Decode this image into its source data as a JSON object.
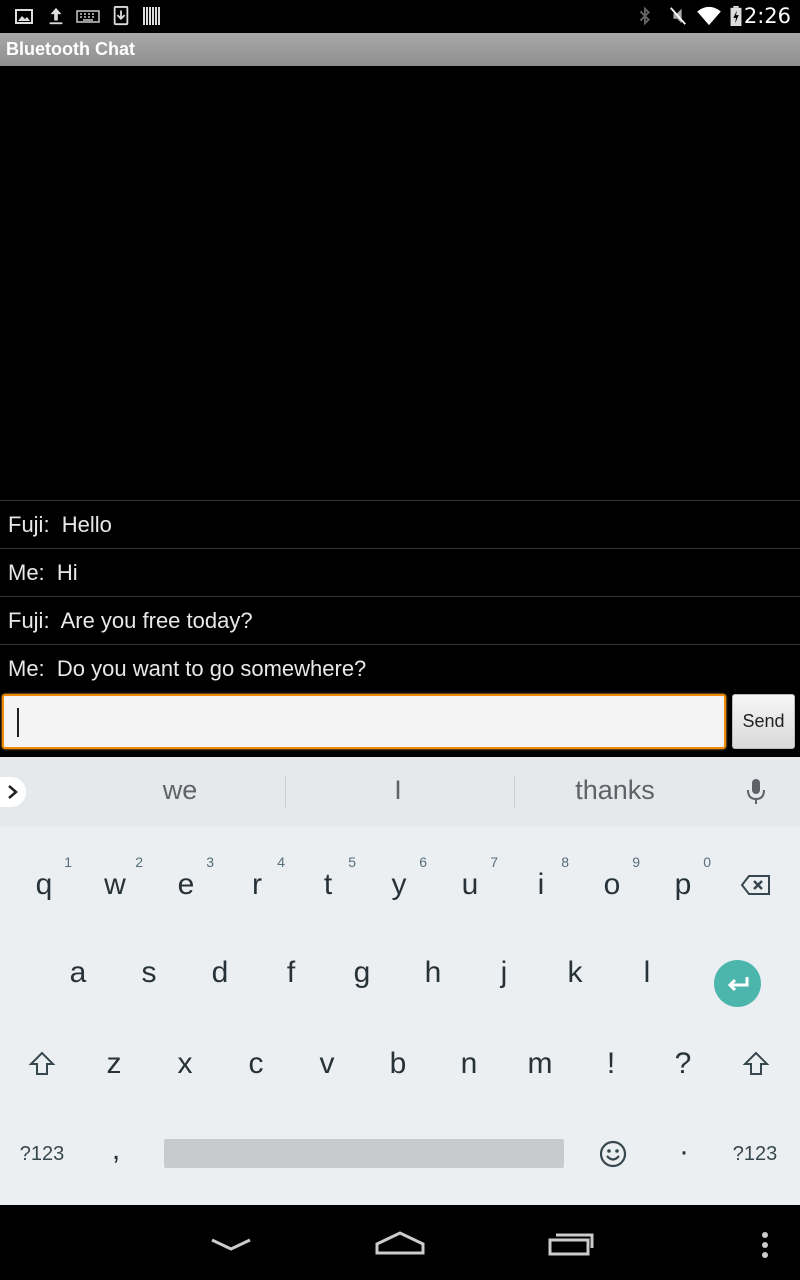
{
  "status_bar": {
    "time": "2:26",
    "icons": [
      "gallery-icon",
      "upload-icon",
      "keyboard-icon",
      "download-icon",
      "barcode-icon",
      "bluetooth-icon",
      "mute-icon",
      "wifi-icon",
      "battery-icon"
    ]
  },
  "app": {
    "title": "Bluetooth Chat"
  },
  "conversation": [
    {
      "text": "Fuji:  Hello"
    },
    {
      "text": "Me:  Hi"
    },
    {
      "text": "Fuji:  Are you free today?"
    },
    {
      "text": "Me:  Do you want to go somewhere?"
    }
  ],
  "compose": {
    "input_value": "",
    "send_label": "Send"
  },
  "keyboard": {
    "suggestions": [
      "we",
      "I",
      "thanks"
    ],
    "row1": [
      {
        "k": "q",
        "h": "1"
      },
      {
        "k": "w",
        "h": "2"
      },
      {
        "k": "e",
        "h": "3"
      },
      {
        "k": "r",
        "h": "4"
      },
      {
        "k": "t",
        "h": "5"
      },
      {
        "k": "y",
        "h": "6"
      },
      {
        "k": "u",
        "h": "7"
      },
      {
        "k": "i",
        "h": "8"
      },
      {
        "k": "o",
        "h": "9"
      },
      {
        "k": "p",
        "h": "0"
      }
    ],
    "row2": [
      "a",
      "s",
      "d",
      "f",
      "g",
      "h",
      "j",
      "k",
      "l"
    ],
    "row3": [
      "z",
      "x",
      "c",
      "v",
      "b",
      "n",
      "m",
      "!",
      "?"
    ],
    "row4": {
      "symbols_left": "?123",
      "comma": ",",
      "period": "·",
      "symbols_right": "?123"
    },
    "accent_color": "#4db6ac"
  },
  "input_focus_color": "#f08a00"
}
